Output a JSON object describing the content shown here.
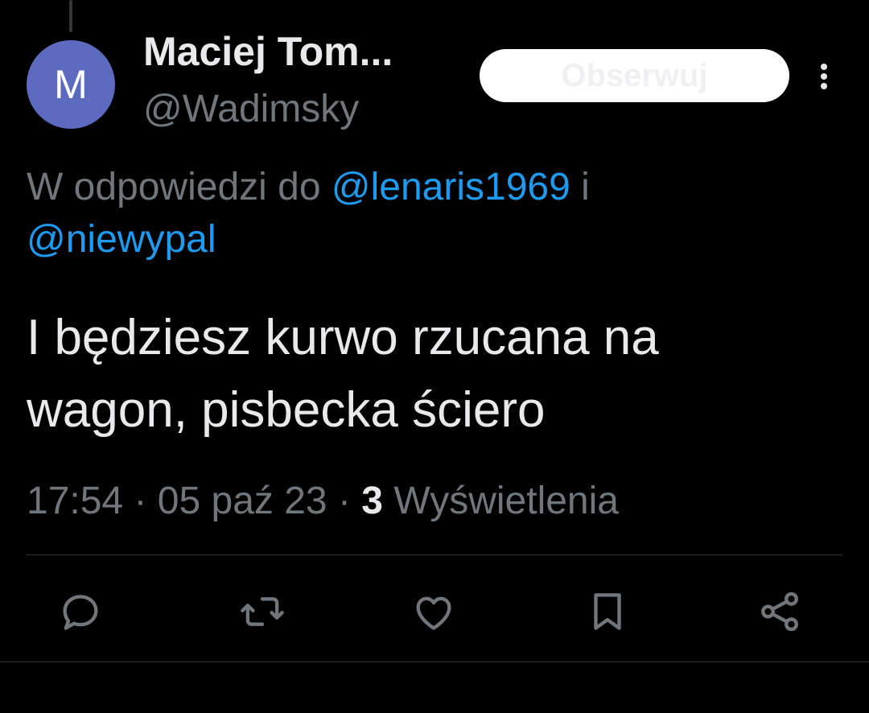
{
  "colors": {
    "background": "#000000",
    "text_primary": "#e7e9ea",
    "text_secondary": "#71767b",
    "link": "#1d9bf0",
    "avatar": "#5c6bc0",
    "follow_button_bg": "#ffffff",
    "divider": "#2f3336"
  },
  "author": {
    "avatar_letter": "M",
    "display_name": "Maciej Tom...",
    "handle": "@Wadimsky"
  },
  "header": {
    "follow_label": "Obserwuj",
    "more_icon": "more-vertical-icon"
  },
  "reply_context": {
    "prefix": "W odpowiedzi do ",
    "mention_1": "@lenaris1969",
    "conjunction": " i",
    "mention_2": "@niewypal"
  },
  "tweet": {
    "line_1": "I będziesz kurwo rzucana na",
    "line_2": "wagon, pisbecka ściero"
  },
  "meta": {
    "time": "17:54",
    "separator": " · ",
    "date": "05 paź 23",
    "views_count": "3",
    "views_label": " Wyświetlenia"
  },
  "actions": [
    {
      "icon": "reply-icon"
    },
    {
      "icon": "retweet-icon"
    },
    {
      "icon": "like-icon"
    },
    {
      "icon": "bookmark-icon"
    },
    {
      "icon": "share-icon"
    }
  ]
}
